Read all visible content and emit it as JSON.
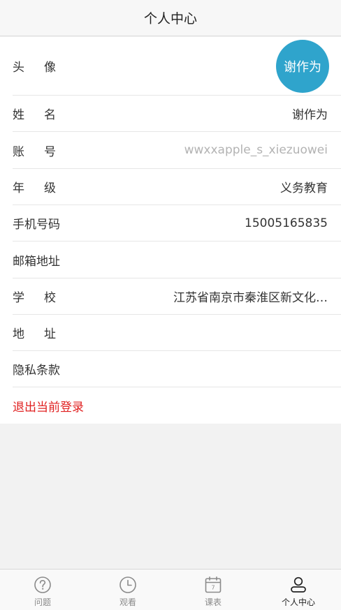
{
  "header": {
    "title": "个人中心"
  },
  "profile": {
    "avatar": {
      "label": "头像",
      "text": "谢作为"
    },
    "name": {
      "label": "姓名",
      "value": "谢作为"
    },
    "account": {
      "label": "账号",
      "value": "wwxxapple_s_xiezuowei"
    },
    "grade": {
      "label": "年级",
      "value": "义务教育"
    },
    "phone": {
      "label": "手机号码",
      "value": "15005165835"
    },
    "email": {
      "label": "邮箱地址",
      "value": ""
    },
    "school": {
      "label": "学校",
      "value": "江苏省南京市秦淮区新文化…"
    },
    "address": {
      "label": "地址",
      "value": ""
    },
    "privacy": {
      "label": "隐私条款"
    },
    "logout": {
      "label": "退出当前登录"
    }
  },
  "tabbar": {
    "items": [
      {
        "label": "问题",
        "icon": "question-icon"
      },
      {
        "label": "观看",
        "icon": "clock-icon"
      },
      {
        "label": "课表",
        "icon": "calendar-icon",
        "calendar_day": "7"
      },
      {
        "label": "个人中心",
        "icon": "person-icon"
      }
    ],
    "active": "个人中心"
  },
  "colors": {
    "accent": "#2fa4cc",
    "logout": "#e02020"
  }
}
